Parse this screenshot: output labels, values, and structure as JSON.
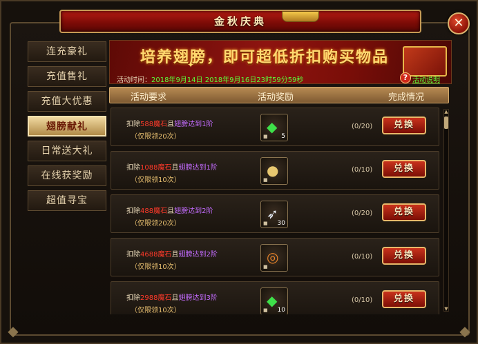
{
  "window": {
    "title": "金秋庆典",
    "close_label": "✕"
  },
  "sidebar": {
    "items": [
      {
        "label": "连充豪礼",
        "active": false
      },
      {
        "label": "充值售礼",
        "active": false
      },
      {
        "label": "充值大优惠",
        "active": false
      },
      {
        "label": "翅膀献礼",
        "active": true
      },
      {
        "label": "日常送大礼",
        "active": false
      },
      {
        "label": "在线获奖励",
        "active": false
      },
      {
        "label": "超值寻宝",
        "active": false
      }
    ]
  },
  "banner": {
    "title": "培养翅膀，即可超低折扣购买物品",
    "time_label": "活动时间：",
    "time_value": "2018年9月14日 2018年9月16日23时59分59秒",
    "help_glyph": "?",
    "rules_label": "活动说明"
  },
  "columns": {
    "requirement": "活动要求",
    "reward": "活动奖励",
    "status": "完成情况"
  },
  "rows": [
    {
      "deduct": "扣除",
      "amount": "588",
      "currency": "魔石",
      "and": "且",
      "condition": "翅膀达到1阶",
      "limit": "（仅限领20次）",
      "item_icon": "green-gem-icon",
      "item_glyph": "◆",
      "item_color": "#3ee04a",
      "count": "5",
      "progress": "(0/20)",
      "button": "兑换"
    },
    {
      "deduct": "扣除",
      "amount": "1088",
      "currency": "魔石",
      "and": "且",
      "condition": "翅膀达到1阶",
      "limit": "（仅限领10次）",
      "item_icon": "gold-coin-icon",
      "item_glyph": "●",
      "item_color": "#e8c870",
      "count": "",
      "progress": "(0/10)",
      "button": "兑换"
    },
    {
      "deduct": "扣除",
      "amount": "488",
      "currency": "魔石",
      "and": "且",
      "condition": "翅膀达到2阶",
      "limit": "（仅限领20次）",
      "item_icon": "white-feather-icon",
      "item_glyph": "➶",
      "item_color": "#e6ecf6",
      "count": "30",
      "progress": "(0/20)",
      "button": "兑换"
    },
    {
      "deduct": "扣除",
      "amount": "4688",
      "currency": "魔石",
      "and": "且",
      "condition": "翅膀达到2阶",
      "limit": "（仅限领10次）",
      "item_icon": "orange-ring-icon",
      "item_glyph": "◎",
      "item_color": "#e8842a",
      "count": "",
      "progress": "(0/10)",
      "button": "兑换"
    },
    {
      "deduct": "扣除",
      "amount": "2988",
      "currency": "魔石",
      "and": "且",
      "condition": "翅膀达到3阶",
      "limit": "（仅限领10次）",
      "item_icon": "green-gem-icon",
      "item_glyph": "◆",
      "item_color": "#3ee04a",
      "count": "10",
      "progress": "(0/10)",
      "button": "兑换"
    }
  ],
  "scrollbar": {
    "up": "▲",
    "down": "▼"
  }
}
